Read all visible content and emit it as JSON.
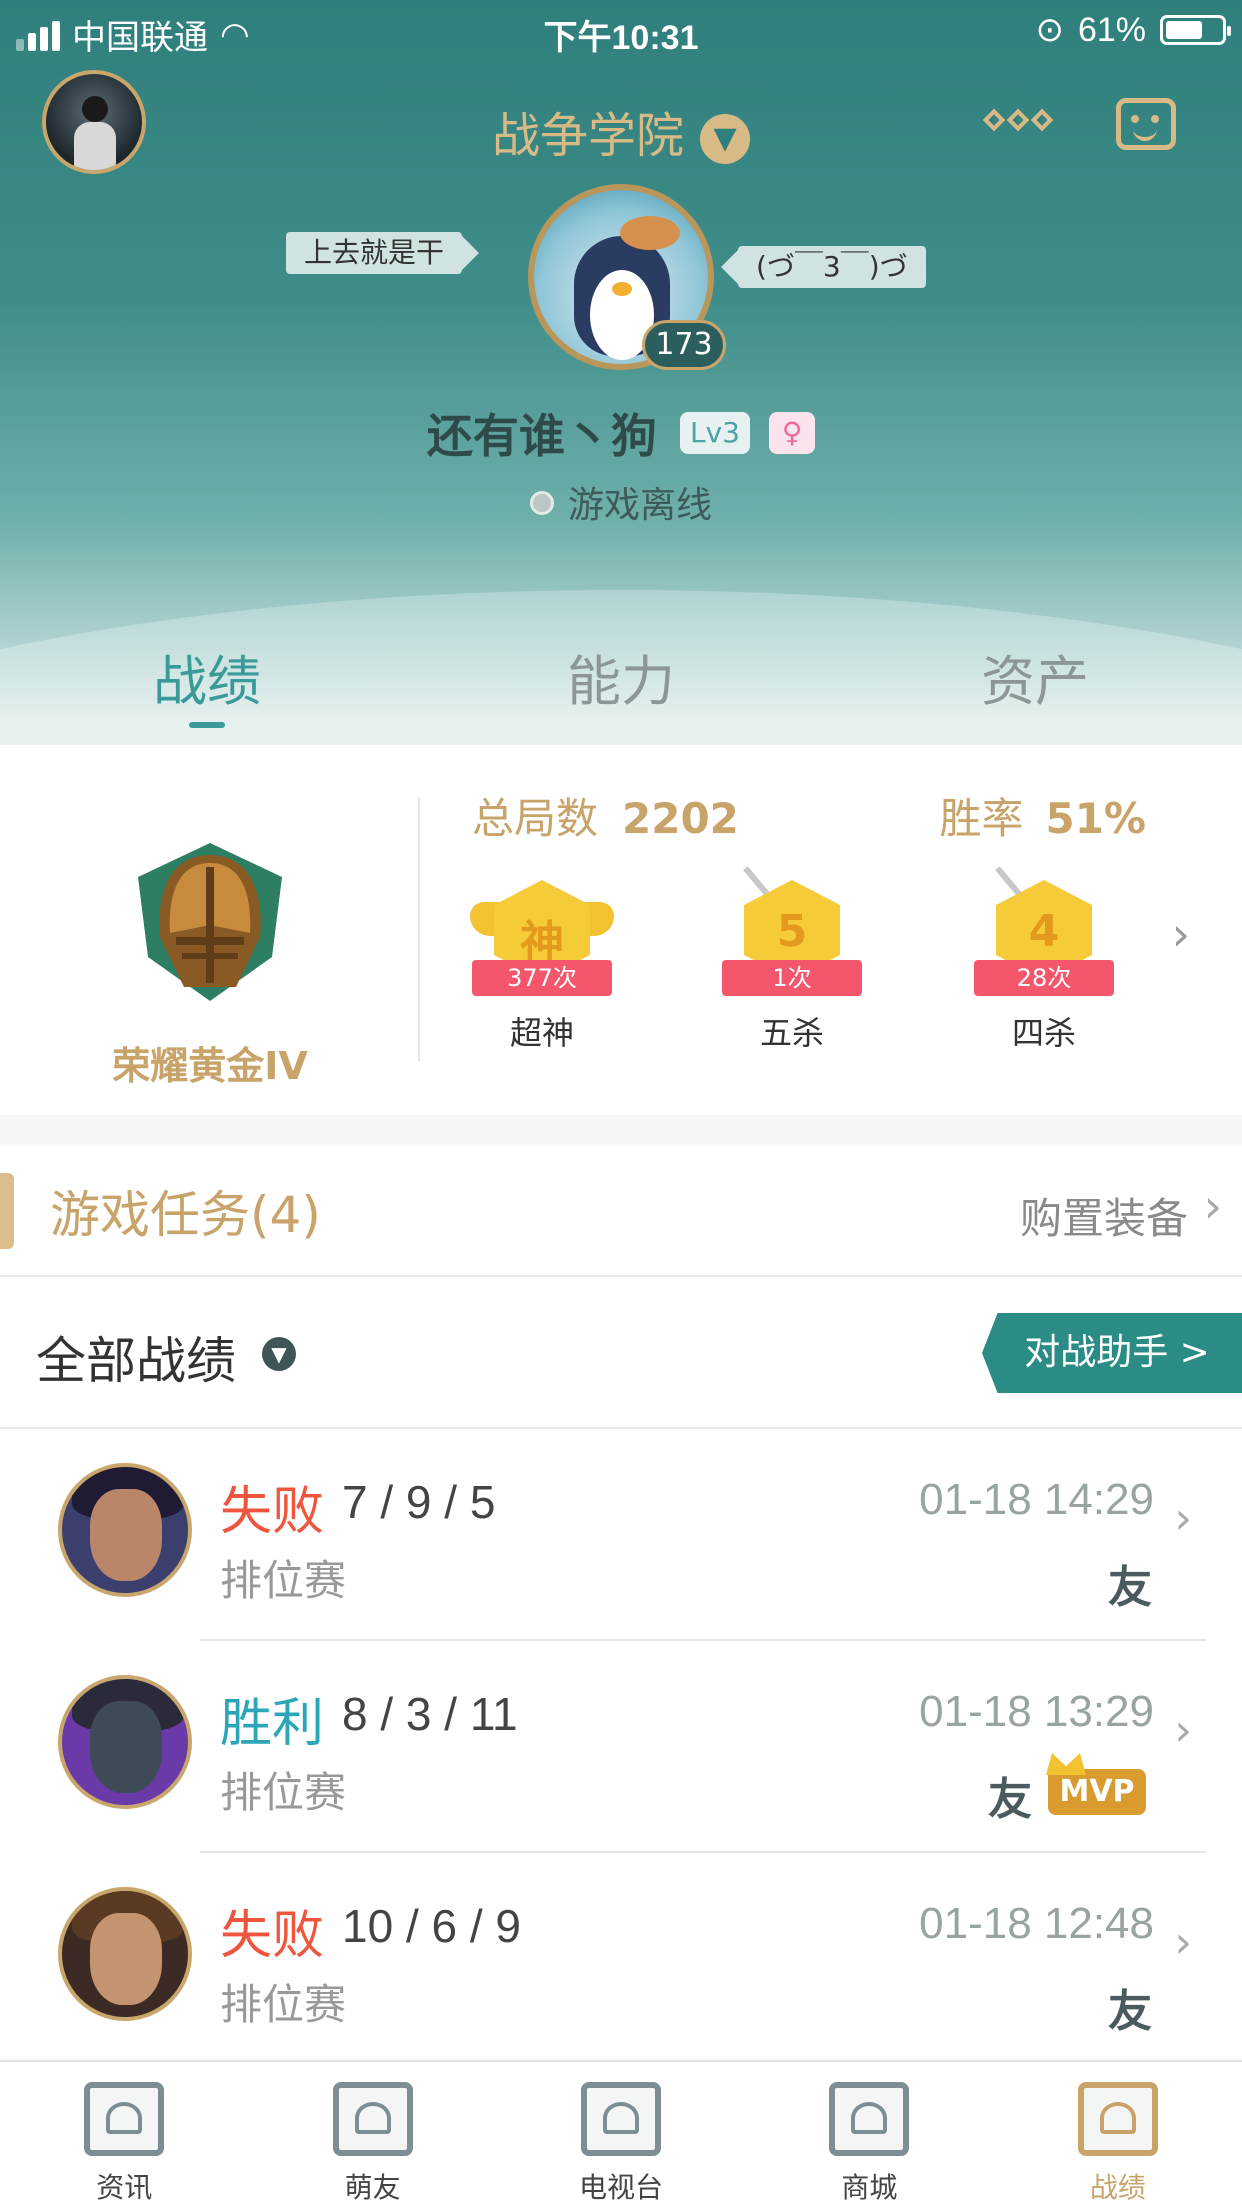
{
  "status_bar": {
    "carrier": "中国联通",
    "time": "下午10:31",
    "battery": "61%"
  },
  "header": {
    "title": "战争学院",
    "tag_left": "上去就是干",
    "tag_right": "(づ￣3￣)づ",
    "level": "173",
    "player_name": "还有谁丶狗",
    "lv": "Lv3",
    "gender_symbol": "♀",
    "status": "游戏离线"
  },
  "tabs": [
    {
      "label": "战绩",
      "active": true
    },
    {
      "label": "能力",
      "active": false
    },
    {
      "label": "资产",
      "active": false
    }
  ],
  "stats": {
    "rank": "荣耀黄金IV",
    "total_label": "总局数",
    "total_value": "2202",
    "rate_label": "胜率",
    "rate_value": "51%",
    "badges": [
      {
        "glyph": "神",
        "count": "377次",
        "label": "超神"
      },
      {
        "glyph": "5",
        "count": "1次",
        "label": "五杀"
      },
      {
        "glyph": "4",
        "count": "28次",
        "label": "四杀"
      }
    ]
  },
  "tasks": {
    "title": "游戏任务(4)",
    "link": "购置装备"
  },
  "records": {
    "title": "全部战绩",
    "assistant": "对战助手 >"
  },
  "matches": [
    {
      "result": "失败",
      "kda": "7 / 9 / 5",
      "mode": "排位赛",
      "time": "01-18 14:29",
      "friend": "友",
      "mvp": ""
    },
    {
      "result": "胜利",
      "kda": "8 / 3 / 11",
      "mode": "排位赛",
      "time": "01-18 13:29",
      "friend": "友",
      "mvp": "MVP"
    },
    {
      "result": "失败",
      "kda": "10 / 6 / 9",
      "mode": "排位赛",
      "time": "01-18 12:48",
      "friend": "友",
      "mvp": ""
    }
  ],
  "bottom_nav": [
    {
      "label": "资讯",
      "icon": "book-icon",
      "active": false
    },
    {
      "label": "萌友",
      "icon": "heart-chat-icon",
      "active": false
    },
    {
      "label": "电视台",
      "icon": "tv-icon",
      "active": false
    },
    {
      "label": "商城",
      "icon": "shop-icon",
      "active": false
    },
    {
      "label": "战绩",
      "icon": "record-icon",
      "active": true
    }
  ],
  "colors": {
    "accent": "#3a9a98",
    "gold": "#c8a36a",
    "loss": "#f0553e",
    "win": "#2aa6b8"
  }
}
